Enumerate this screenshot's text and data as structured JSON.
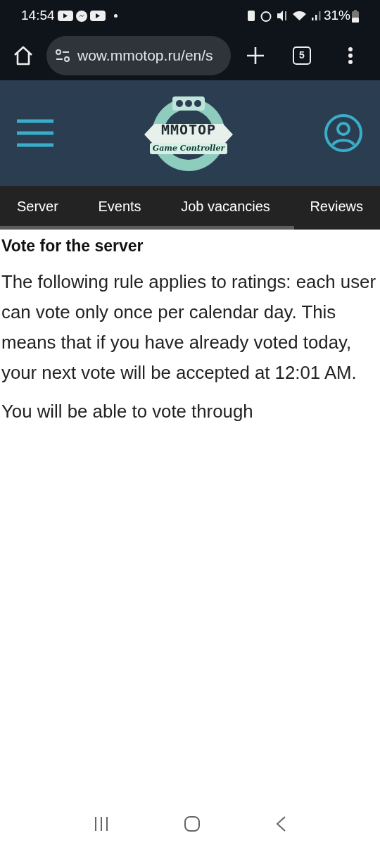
{
  "status_bar": {
    "time": "14:54",
    "battery": "31%"
  },
  "browser": {
    "url": "wow.mmotop.ru/en/s",
    "tab_count": "5"
  },
  "header": {
    "logo": {
      "title": "MMOTOP",
      "subtitle": "Game Controller"
    }
  },
  "nav": {
    "items": [
      {
        "label": "Server"
      },
      {
        "label": "Events"
      },
      {
        "label": "Job vacancies"
      },
      {
        "label": "Reviews"
      }
    ]
  },
  "content": {
    "heading": "Vote for the server",
    "paragraphs": [
      "The following rule applies to ratings: each user can vote only once per calendar day. This means that if you have already voted today, your next vote will be accepted at 12:01 AM.",
      "You will be able to vote through"
    ]
  }
}
